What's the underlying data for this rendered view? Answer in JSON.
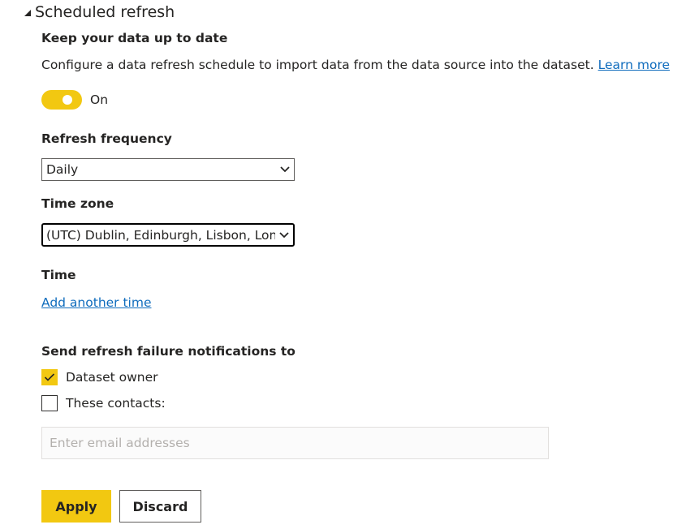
{
  "section": {
    "title": "Scheduled refresh"
  },
  "keep_up_to_date": {
    "heading": "Keep your data up to date",
    "description": "Configure a data refresh schedule to import data from the data source into the dataset.",
    "learn_more": "Learn more"
  },
  "toggle": {
    "state": "on",
    "label": "On",
    "color": "#f2c811"
  },
  "refresh_frequency": {
    "label": "Refresh frequency",
    "selected": "Daily"
  },
  "time_zone": {
    "label": "Time zone",
    "selected": "(UTC) Dublin, Edinburgh, Lisbon, London"
  },
  "time": {
    "label": "Time",
    "add_link": "Add another time"
  },
  "notifications": {
    "heading": "Send refresh failure notifications to",
    "options": [
      {
        "label": "Dataset owner",
        "checked": true
      },
      {
        "label": "These contacts:",
        "checked": false
      }
    ],
    "email_placeholder": "Enter email addresses"
  },
  "actions": {
    "apply": "Apply",
    "discard": "Discard"
  },
  "colors": {
    "accent": "#f2c811",
    "link": "#0f6cbd",
    "text": "#252423"
  }
}
